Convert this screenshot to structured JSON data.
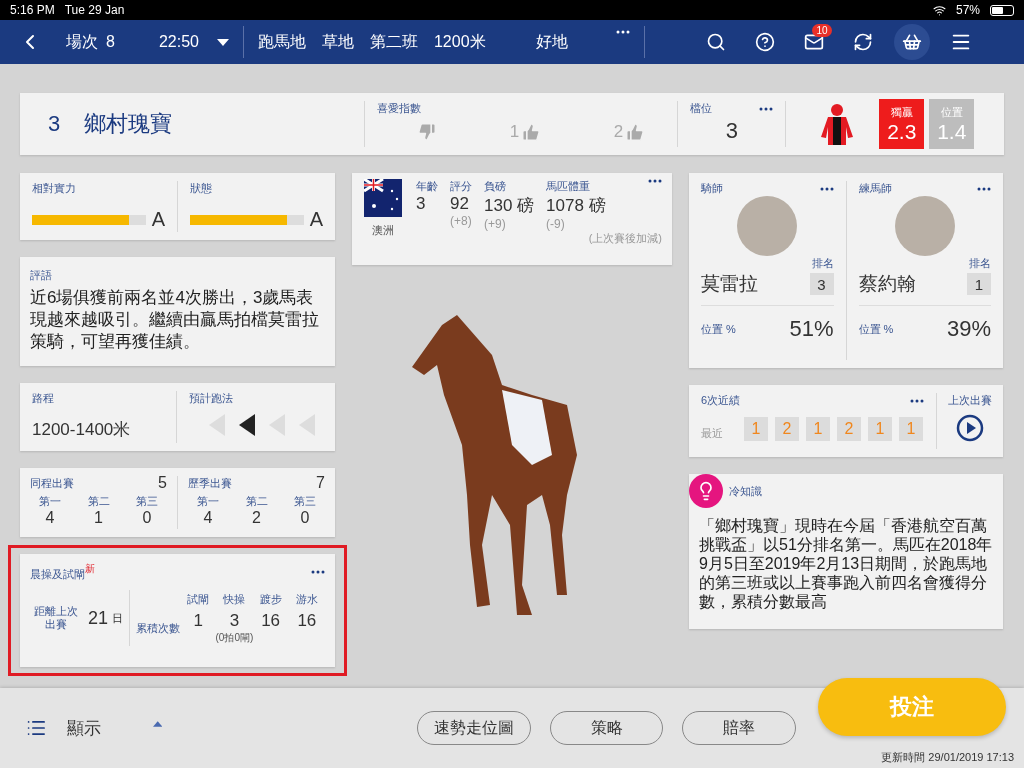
{
  "status_bar": {
    "time": "5:16 PM",
    "date": "Tue 29 Jan",
    "battery": "57%"
  },
  "nav": {
    "race_label": "場次",
    "race_no": "8",
    "time": "22:50",
    "venue": "跑馬地",
    "surface": "草地",
    "race_class": "第二班",
    "distance": "1200米",
    "going": "好地",
    "mail_badge": "10"
  },
  "horse": {
    "number": "3",
    "name": "鄉村瑰寶",
    "favour_title": "喜愛指數",
    "favour": [
      {
        "kind": "down"
      },
      {
        "kind": "up",
        "label": "1"
      },
      {
        "kind": "up",
        "label": "2"
      }
    ],
    "draw_title": "檔位",
    "draw": "3",
    "odds": [
      {
        "kind": "win",
        "label": "獨贏",
        "value": "2.3"
      },
      {
        "kind": "place",
        "label": "位置",
        "value": "1.4"
      }
    ]
  },
  "ratings": [
    {
      "label": "相對實力",
      "level": 0.85,
      "grade": "A"
    },
    {
      "label": "狀態",
      "level": 0.85,
      "grade": "A"
    }
  ],
  "comment": {
    "title": "評語",
    "text": "近6場俱獲前兩名並4次勝出，3歲馬表現越來越吸引。繼續由贏馬拍檔莫雷拉策騎，可望再獲佳績。"
  },
  "distance": {
    "title": "路程",
    "value": "1200-1400米"
  },
  "running_style": {
    "title": "預計跑法",
    "arrows": [
      {
        "selected": false
      },
      {
        "selected": true
      },
      {
        "selected": false
      },
      {
        "selected": false
      }
    ]
  },
  "records": [
    {
      "title": "同程出賽",
      "total": "5",
      "places": [
        {
          "label": "第一",
          "value": "4"
        },
        {
          "label": "第二",
          "value": "1"
        },
        {
          "label": "第三",
          "value": "0"
        }
      ]
    },
    {
      "title": "歷季出賽",
      "total": "7",
      "places": [
        {
          "label": "第一",
          "value": "4"
        },
        {
          "label": "第二",
          "value": "2"
        },
        {
          "label": "第三",
          "value": "0"
        }
      ]
    }
  ],
  "trackwork": {
    "title": "晨操及試閘",
    "badge": "新",
    "highlighted": true,
    "since_label": "距離上次出賽",
    "since_value": "21",
    "since_unit": "日",
    "count_label": "累積次數",
    "columns": [
      {
        "label": "試閘",
        "value": "1"
      },
      {
        "label": "快操",
        "value": "3",
        "note": "(0拍0閘)"
      },
      {
        "label": "踱步",
        "value": "16"
      },
      {
        "label": "游水",
        "value": "16"
      }
    ]
  },
  "profile": {
    "country": "澳洲",
    "stats": [
      {
        "label": "年齡",
        "value": "3"
      },
      {
        "label": "評分",
        "value": "92",
        "change": "(+8)"
      },
      {
        "label": "負磅",
        "value": "130 磅",
        "change": "(+9)"
      },
      {
        "label": "馬匹體重",
        "value": "1078 磅",
        "change": "(-9)"
      }
    ],
    "footnote": "(上次賽後加減)"
  },
  "people": [
    {
      "role": "騎師",
      "rank_label": "排名",
      "name": "莫雷拉",
      "rank": "3",
      "stat_label": "位置 %",
      "stat": "51%"
    },
    {
      "role": "練馬師",
      "rank_label": "排名",
      "name": "蔡約翰",
      "rank": "1",
      "stat_label": "位置 %",
      "stat": "39%"
    }
  ],
  "recent": {
    "title": "6次近績",
    "latest_label": "最近",
    "results": [
      "1",
      "2",
      "1",
      "2",
      "1",
      "1"
    ],
    "replay_label": "上次出賽"
  },
  "trivia": {
    "title": "冷知識",
    "text": "「鄉村瑰寶」現時在今屆「香港航空百萬挑戰盃」以51分排名第一。馬匹在2018年9月5日至2019年2月13日期間，於跑馬地的第三班或以上賽事跑入前四名會獲得分數，累積分數最高"
  },
  "bottom": {
    "display_label": "顯示",
    "buttons": [
      "速勢走位圖",
      "策略",
      "賠率"
    ],
    "bet": "投注",
    "updated": "更新時間 29/01/2019 17:13"
  }
}
